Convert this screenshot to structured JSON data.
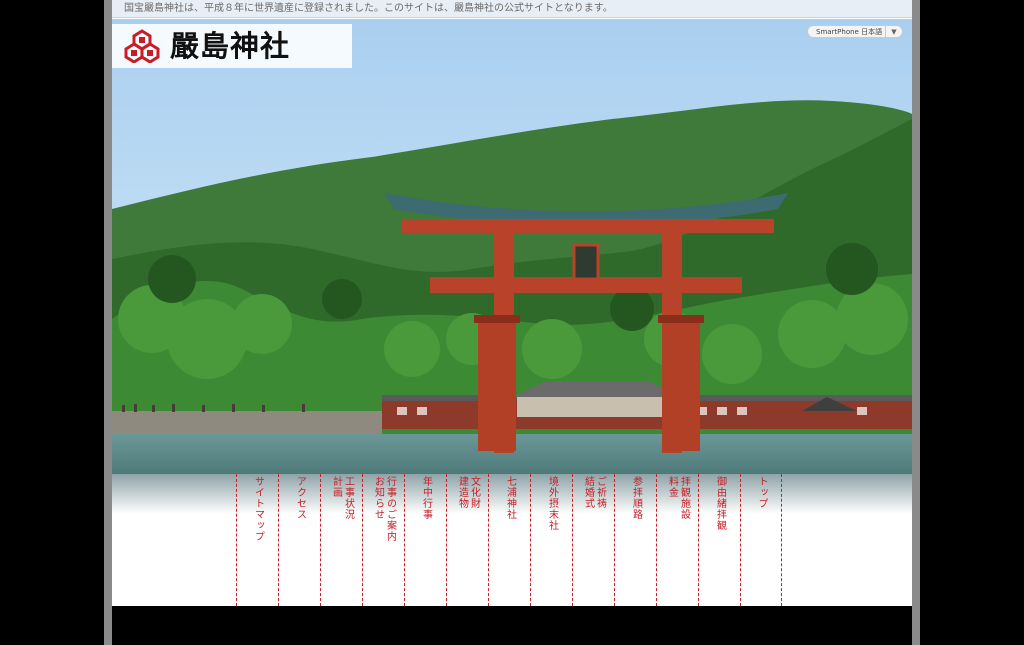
{
  "notice": "国宝嚴島神社は、平成８年に世界遺産に登録されました。このサイトは、嚴島神社の公式サイトとなります。",
  "logo": {
    "text": "嚴島神社",
    "crest_icon": "mitsu-mori-crest-icon"
  },
  "smartphone_switch": {
    "label": "SmartPhone 日本語",
    "arrow": "▼"
  },
  "hero": {
    "alt": "海に立つ大鳥居と嚴島神社社殿"
  },
  "nav": [
    {
      "label": "サイトマップ"
    },
    {
      "label": "アクセス"
    },
    {
      "label": "工事状況\n計画"
    },
    {
      "label": "行事のご案内\nお知らせ"
    },
    {
      "label": "年中行事"
    },
    {
      "label": "文化財\n建造物"
    },
    {
      "label": "七浦神社"
    },
    {
      "label": "境外摂末社"
    },
    {
      "label": "ご祈祷\n結婚式"
    },
    {
      "label": "参拝順路"
    },
    {
      "label": "拝観施設\n料金"
    },
    {
      "label": "御由緒拝観"
    },
    {
      "label": "トップ"
    }
  ],
  "colors": {
    "nav_red": "#c71d24",
    "sky": "#b9dbf2",
    "forest": "#2f6a2a",
    "torii": "#b8422a",
    "water": "#5f8c8c"
  }
}
